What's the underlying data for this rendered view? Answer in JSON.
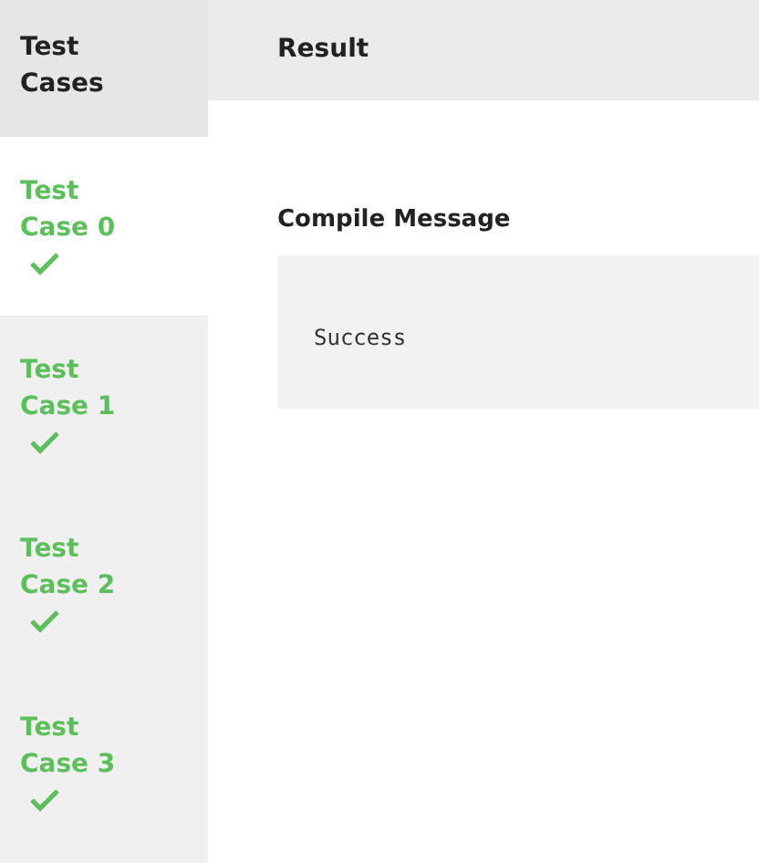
{
  "sidebar": {
    "title": "Test Cases",
    "items": [
      {
        "label": "Test Case 0",
        "selected": true,
        "passed": true
      },
      {
        "label": "Test Case 1",
        "selected": false,
        "passed": true
      },
      {
        "label": "Test Case 2",
        "selected": false,
        "passed": true
      },
      {
        "label": "Test Case 3",
        "selected": false,
        "passed": true
      }
    ]
  },
  "result": {
    "title": "Result",
    "compile_message": {
      "heading": "Compile Message",
      "text": "Success"
    }
  }
}
